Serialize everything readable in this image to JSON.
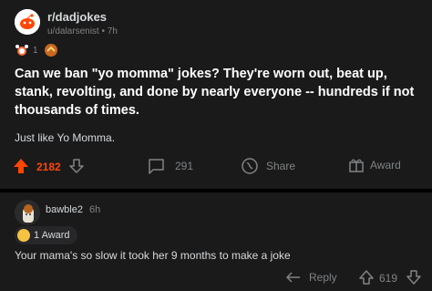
{
  "post": {
    "subreddit": "r/dadjokes",
    "username": "u/dalarsenist",
    "age": "7h",
    "awards": [
      {
        "icon": "reddit-gold-icon",
        "count": "1"
      },
      {
        "icon": "award-icon",
        "count": ""
      }
    ],
    "title": "Can we ban \"yo momma\" jokes? They're worn out, beat up, stank, revolting, and done by nearly everyone -- hundreds if not thousands of times.",
    "body": "Just like Yo Momma.",
    "actions": {
      "votes": "2182",
      "comments": "291",
      "share": "Share",
      "award": "Award"
    },
    "colors": {
      "upvote": "#ff4500",
      "background": "#1a1a1b",
      "page": "#000000"
    }
  },
  "comment": {
    "username": "bawble2",
    "age": "6h",
    "award_label": "1 Award",
    "text": "Your mama's so slow it took her 9 months to make a joke",
    "reply": "Reply",
    "votes": "619"
  }
}
